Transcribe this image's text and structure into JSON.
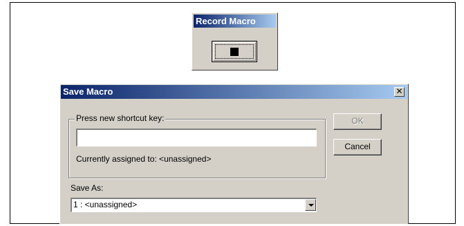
{
  "record_toolbar": {
    "title": "Record Macro",
    "stop_icon": "stop-icon"
  },
  "dialog": {
    "title": "Save Macro",
    "close_icon": "close-icon",
    "shortcut_group_label": "Press new shortcut key:",
    "shortcut_value": "",
    "assigned_text": "Currently assigned to: <unassigned>",
    "ok_label": "OK",
    "cancel_label": "Cancel",
    "save_as_label": "Save As:",
    "save_as_selected": "1 : <unassigned>"
  },
  "colors": {
    "face": "#d4d0c8",
    "title_start": "#0a246a",
    "title_end": "#a6caf0"
  }
}
